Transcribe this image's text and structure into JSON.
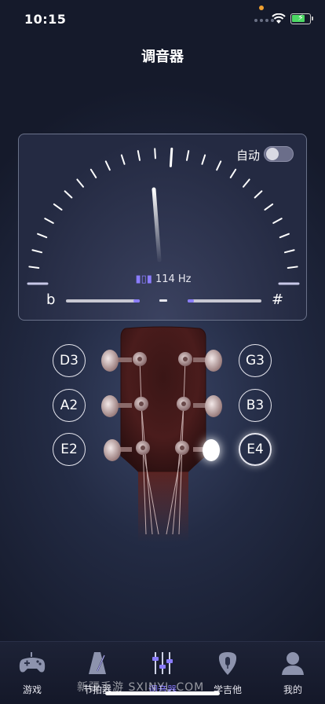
{
  "status": {
    "time": "10:15"
  },
  "header": {
    "title": "调音器"
  },
  "tuner": {
    "auto_label": "自动",
    "auto_enabled": false,
    "frequency": "114 Hz",
    "flat_symbol": "b",
    "sharp_symbol": "#"
  },
  "strings": [
    {
      "label": "D3",
      "active": false
    },
    {
      "label": "A2",
      "active": false
    },
    {
      "label": "E2",
      "active": false
    },
    {
      "label": "G3",
      "active": false
    },
    {
      "label": "B3",
      "active": false
    },
    {
      "label": "E4",
      "active": true
    }
  ],
  "tabs": [
    {
      "label": "游戏",
      "icon": "gamepad-icon",
      "active": false
    },
    {
      "label": "节拍器",
      "icon": "metronome-icon",
      "active": false
    },
    {
      "label": "调音器",
      "icon": "tuner-sliders-icon",
      "active": true
    },
    {
      "label": "学吉他",
      "icon": "guitar-pick-icon",
      "active": false
    },
    {
      "label": "我的",
      "icon": "profile-icon",
      "active": false
    }
  ],
  "watermark": "新疆手游 SXINYL.COM",
  "colors": {
    "accent": "#8a7cff",
    "background": "#1b2135",
    "text": "#ffffff"
  }
}
